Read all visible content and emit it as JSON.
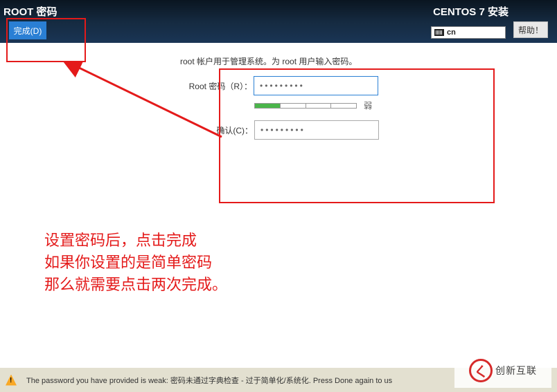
{
  "header": {
    "title_left": "ROOT 密码",
    "title_right": "CENTOS 7 安装",
    "done_label": "完成(D)",
    "help_label": "帮助！",
    "keyboard_layout": "cn"
  },
  "form": {
    "description": "root 帐户用于管理系统。为 root 用户输入密码。",
    "password_label": "Root 密码（R）：",
    "password_value": "•••••••••",
    "confirm_label": "确认(C)：",
    "confirm_value": "•••••••••",
    "strength_text": "弱",
    "strength_segments": 4,
    "strength_filled": 1
  },
  "annotations": {
    "line1": "设置密码后，点击完成",
    "line2": "如果你设置的是简单密码",
    "line3": "那么就需要点击两次完成。",
    "box_top_color": "#e41a1a",
    "box_main_color": "#e41a1a",
    "arrow_color": "#e41a1a"
  },
  "warning": {
    "text": "The password you have provided is weak: 密码未通过字典检查 - 过于简单化/系统化. Press Done again to us"
  },
  "watermark": {
    "symbol": "く",
    "text": "创新互联"
  }
}
